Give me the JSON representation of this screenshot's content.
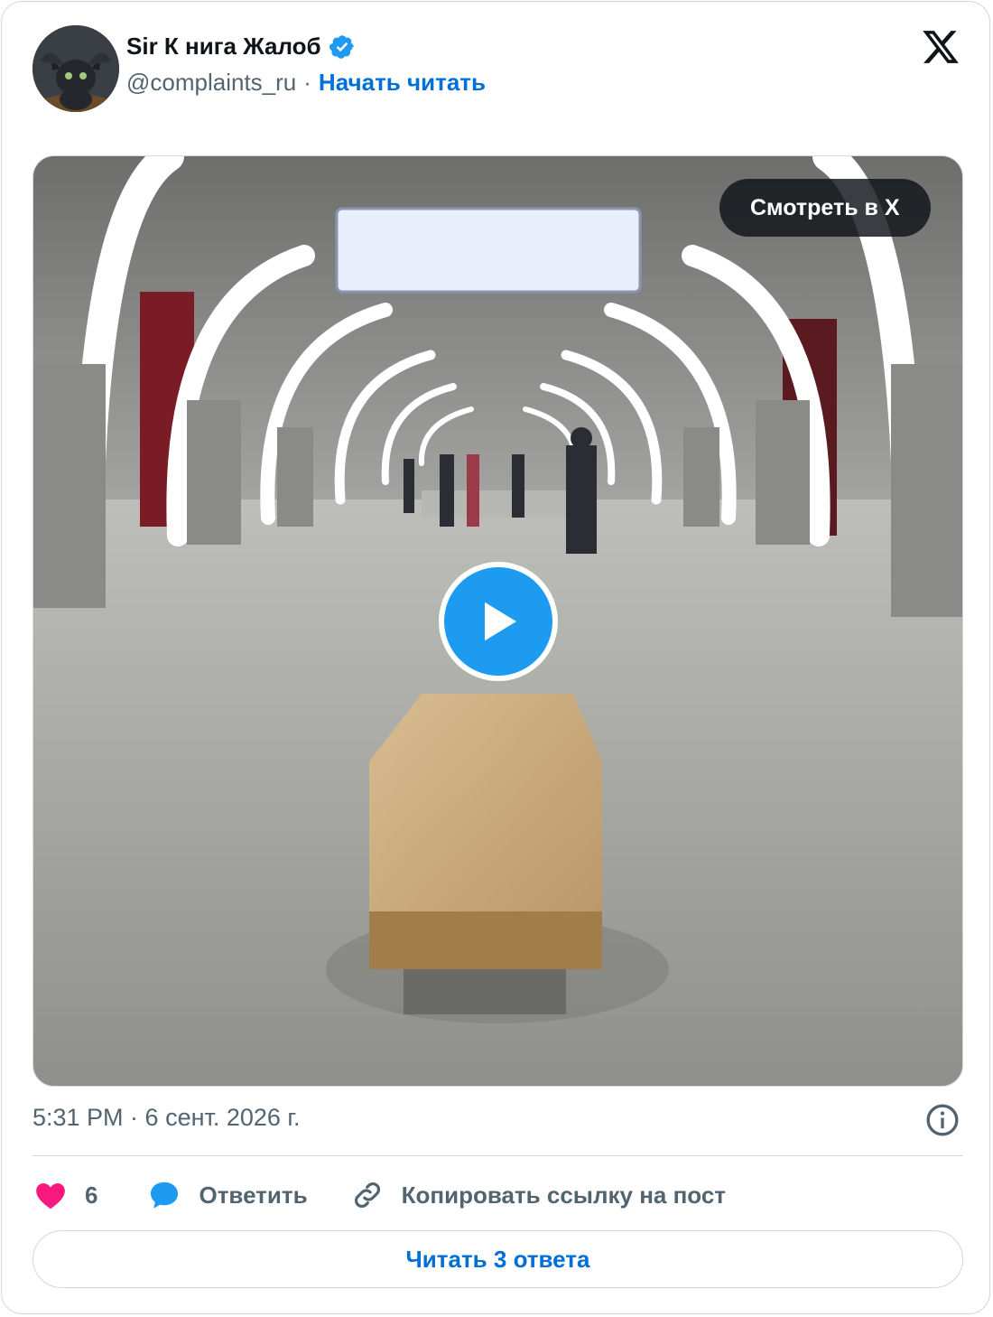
{
  "author": {
    "name": "Sir К нига Жалоб",
    "handle": "@complaints_ru",
    "separator": "·",
    "follow_label": "Начать читать",
    "verified": true
  },
  "media": {
    "watch_label": "Смотреть в X",
    "type": "video"
  },
  "timestamp": "5:31 PM · 6 сент. 2026 г.",
  "actions": {
    "like_count": "6",
    "reply_label": "Ответить",
    "copy_label": "Копировать ссылку на пост"
  },
  "read_replies_label": "Читать 3 ответа",
  "colors": {
    "accent": "#1d9bf0",
    "link": "#006fd6",
    "like": "#f91880",
    "text": "#0f1419",
    "secondary": "#536471"
  },
  "icons": [
    "x-logo-icon",
    "verified-badge-icon",
    "play-icon",
    "info-icon",
    "heart-icon",
    "reply-bubble-icon",
    "link-icon"
  ]
}
